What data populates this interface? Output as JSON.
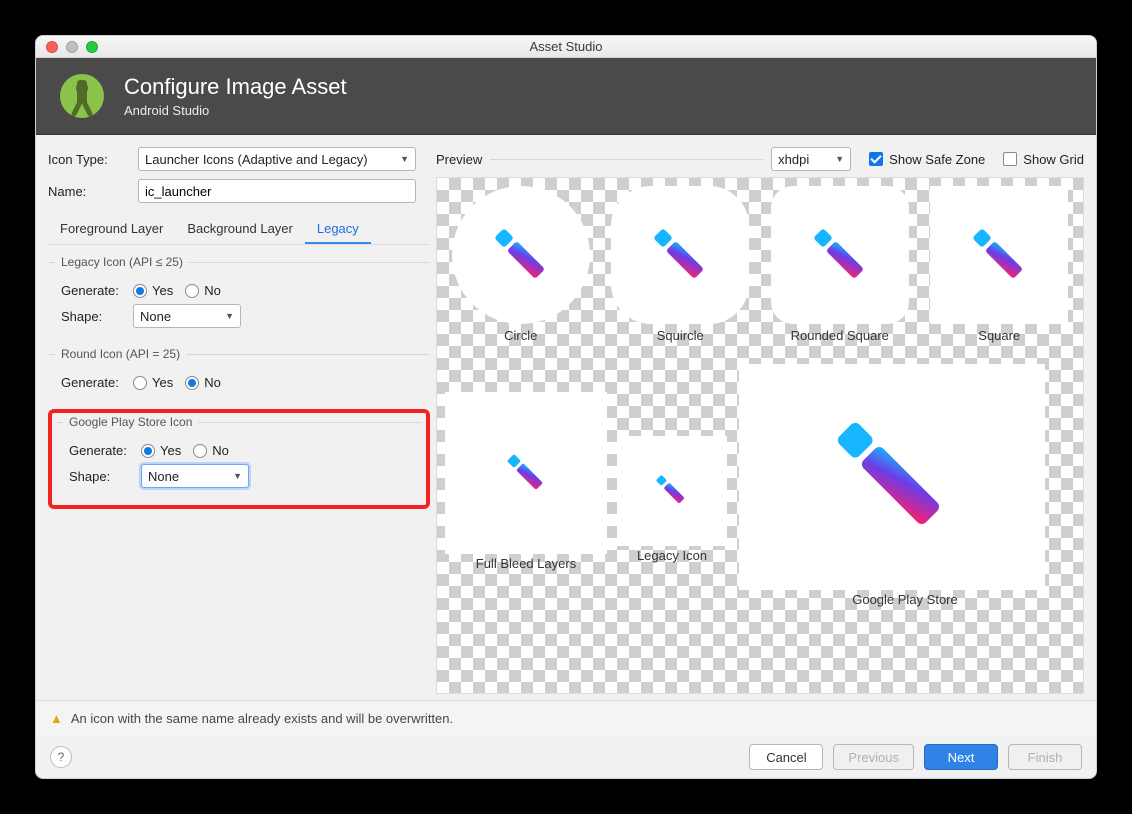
{
  "window": {
    "title": "Asset Studio"
  },
  "header": {
    "title": "Configure Image Asset",
    "subtitle": "Android Studio"
  },
  "form": {
    "icon_type_label": "Icon Type:",
    "icon_type_value": "Launcher Icons (Adaptive and Legacy)",
    "name_label": "Name:",
    "name_value": "ic_launcher",
    "tabs": [
      "Foreground Layer",
      "Background Layer",
      "Legacy"
    ],
    "active_tab": 2
  },
  "legacy_icon": {
    "legend": "Legacy Icon (API ≤ 25)",
    "generate_label": "Generate:",
    "generate": "Yes",
    "yes": "Yes",
    "no": "No",
    "shape_label": "Shape:",
    "shape_value": "None"
  },
  "round_icon": {
    "legend": "Round Icon (API = 25)",
    "generate_label": "Generate:",
    "generate": "No",
    "yes": "Yes",
    "no": "No"
  },
  "gps_icon": {
    "legend": "Google Play Store Icon",
    "generate_label": "Generate:",
    "generate": "Yes",
    "yes": "Yes",
    "no": "No",
    "shape_label": "Shape:",
    "shape_value": "None"
  },
  "preview": {
    "label": "Preview",
    "density_value": "xhdpi",
    "safe_zone_label": "Show Safe Zone",
    "safe_zone_checked": true,
    "grid_label": "Show Grid",
    "grid_checked": false,
    "shapes": [
      "Circle",
      "Squircle",
      "Rounded Square",
      "Square"
    ],
    "bottom": [
      "Full Bleed Layers",
      "Legacy Icon",
      "Google Play Store"
    ]
  },
  "footer": {
    "warning": "An icon with the same name already exists and will be overwritten.",
    "cancel": "Cancel",
    "previous": "Previous",
    "next": "Next",
    "finish": "Finish"
  }
}
